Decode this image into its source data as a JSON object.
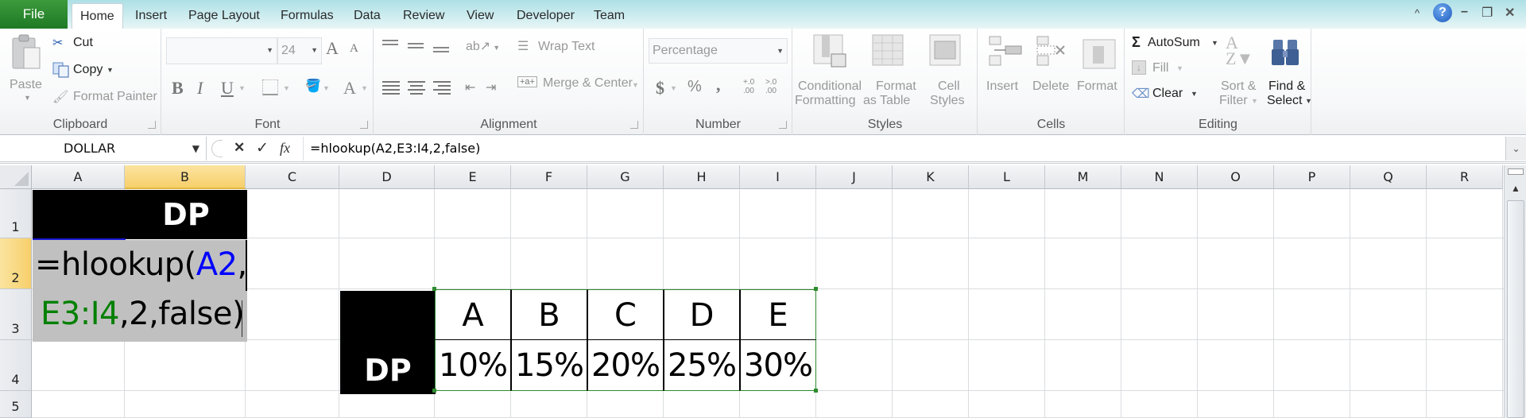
{
  "tabs": {
    "file": "File",
    "items": [
      "Home",
      "Insert",
      "Page Layout",
      "Formulas",
      "Data",
      "Review",
      "View",
      "Developer",
      "Team"
    ],
    "active": "Home"
  },
  "window_controls": {
    "collapse": "^",
    "help": "?",
    "minimize": "–",
    "restore": "❐",
    "close": "✕"
  },
  "ribbon": {
    "clipboard": {
      "label": "Clipboard",
      "paste": "Paste",
      "cut": "Cut",
      "copy": "Copy",
      "format_painter": "Format Painter"
    },
    "font": {
      "label": "Font",
      "font_name": "",
      "font_size": "24",
      "bold": "B",
      "italic": "I",
      "underline": "U",
      "grow": "A",
      "shrink": "A",
      "font_color": "A"
    },
    "alignment": {
      "label": "Alignment",
      "wrap_text": "Wrap Text",
      "merge_center": "Merge & Center"
    },
    "number": {
      "label": "Number",
      "format": "Percentage",
      "currency": "$",
      "percent": "%",
      "comma": ",",
      "inc_decimal": "+.0 .00",
      "dec_decimal": ">.0 .00"
    },
    "styles": {
      "label": "Styles",
      "conditional_formatting": [
        "Conditional",
        "Formatting"
      ],
      "format_as_table": [
        "Format",
        "as Table"
      ],
      "cell_styles": [
        "Cell",
        "Styles"
      ]
    },
    "cells": {
      "label": "Cells",
      "insert": "Insert",
      "delete": "Delete",
      "format": "Format"
    },
    "editing": {
      "label": "Editing",
      "autosum": "AutoSum",
      "fill": "Fill",
      "clear": "Clear",
      "sort_filter": [
        "Sort &",
        "Filter"
      ],
      "find_select": [
        "Find &",
        "Select"
      ]
    }
  },
  "formula_bar": {
    "name_box": "DOLLAR",
    "cancel": "✕",
    "enter": "✓",
    "fx": "fx",
    "formula": "=hlookup(A2,E3:I4,2,false)"
  },
  "columns": [
    "A",
    "B",
    "C",
    "D",
    "E",
    "F",
    "G",
    "H",
    "I",
    "J",
    "K",
    "L",
    "M",
    "N",
    "O",
    "P",
    "Q",
    "R"
  ],
  "selected_column": "B",
  "rows": [
    "1",
    "2",
    "3",
    "4",
    "5"
  ],
  "selected_row": "2",
  "cells": {
    "B1": "DP",
    "B2_line1": {
      "prefix": "=hlookup(",
      "ref1": "A2",
      "sep": ","
    },
    "B2_line2": {
      "ref2": "E3:I4",
      "rest": ",2,false)"
    },
    "D4": "DP",
    "lookup_headers": [
      "A",
      "B",
      "C",
      "D",
      "E"
    ],
    "lookup_values": [
      "10%",
      "15%",
      "20%",
      "25%",
      "30%"
    ]
  },
  "colors": {
    "ref1": "#0000ff",
    "ref2": "#008000",
    "range_border": "#2e8b2e",
    "header_fill": "#000000",
    "edit_fill": "#c0c0c0"
  }
}
